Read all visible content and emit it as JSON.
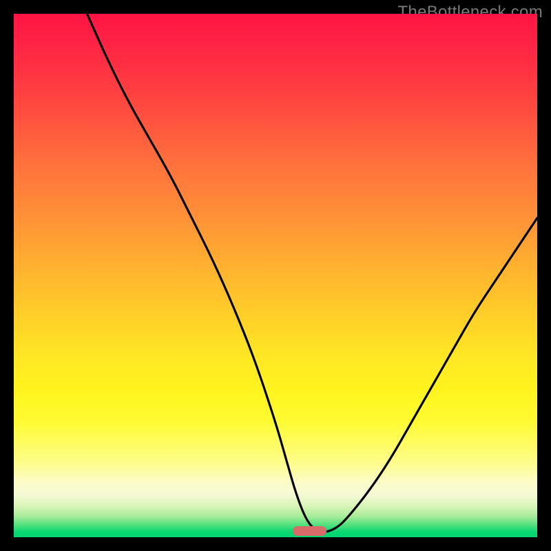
{
  "watermark": "TheBottleneck.com",
  "marker": {
    "x_pct": 56.5,
    "width_pct": 6.5
  },
  "chart_data": {
    "type": "line",
    "title": "",
    "xlabel": "",
    "ylabel": "",
    "xlim": [
      0,
      100
    ],
    "ylim": [
      0,
      100
    ],
    "series": [
      {
        "name": "bottleneck-curve",
        "x": [
          14,
          18,
          22,
          26,
          30,
          34,
          38,
          42,
          46,
          50,
          52,
          54,
          56,
          58,
          60,
          62,
          64,
          68,
          72,
          76,
          80,
          84,
          88,
          92,
          96,
          100
        ],
        "y": [
          100,
          91,
          83,
          76,
          69,
          61,
          53,
          44,
          34,
          22,
          15,
          8,
          3,
          1,
          1,
          2,
          4,
          9,
          15,
          22,
          29,
          36,
          43,
          49,
          55,
          61
        ]
      }
    ],
    "annotations": [
      {
        "type": "pill",
        "x_pct": 56.5,
        "width_pct": 6.5,
        "color": "#d96a6a",
        "meaning": "optimal-range"
      }
    ],
    "background_gradient": {
      "orientation": "vertical",
      "stops": [
        {
          "pct": 0,
          "color": "#ff1444"
        },
        {
          "pct": 50,
          "color": "#ffd028"
        },
        {
          "pct": 80,
          "color": "#fffb33"
        },
        {
          "pct": 100,
          "color": "#00d56e"
        }
      ]
    }
  }
}
